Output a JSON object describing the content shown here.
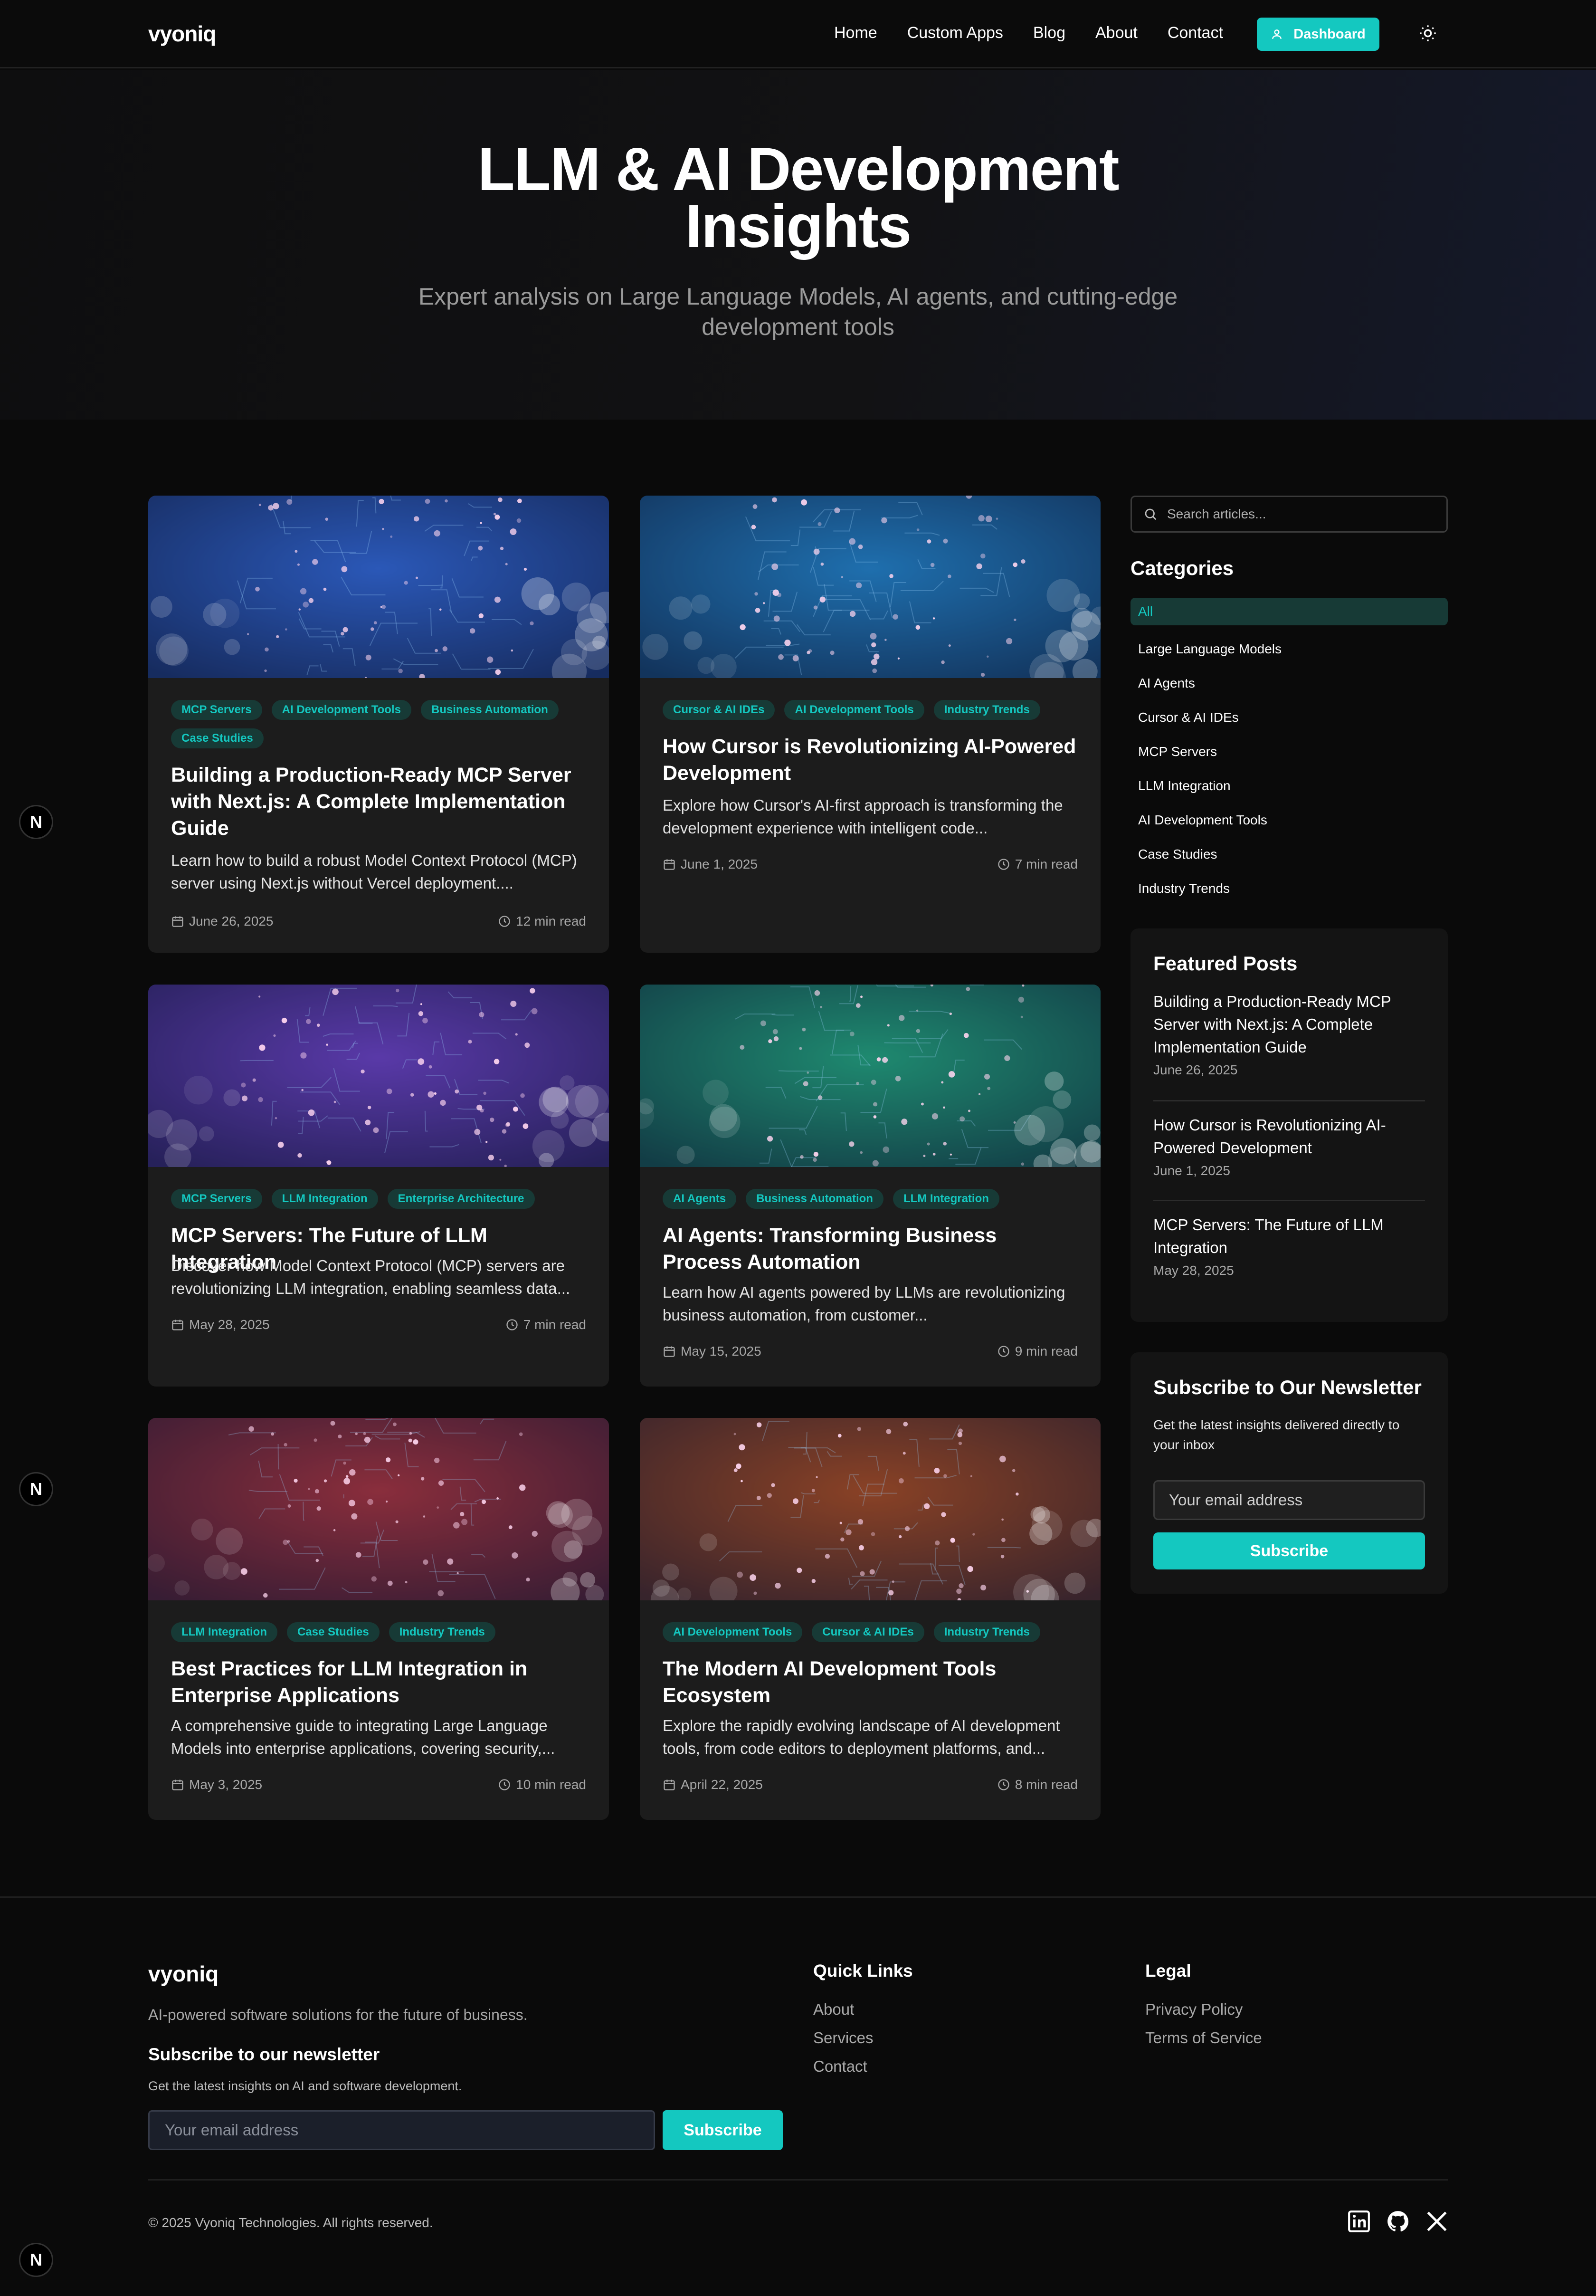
{
  "nav": {
    "logo": "vyoniq",
    "links": [
      "Home",
      "Custom Apps",
      "Blog",
      "About",
      "Contact"
    ],
    "dashboard_label": "Dashboard"
  },
  "hero": {
    "title": "LLM & AI Development Insights",
    "subtitle": "Expert analysis on Large Language Models, AI agents, and cutting-edge development tools"
  },
  "posts": [
    {
      "tags": [
        "MCP Servers",
        "AI Development Tools",
        "Business Automation",
        "Case Studies"
      ],
      "title": "Building a Production-Ready MCP Server with Next.js: A Complete Implementation Guide",
      "excerpt": "Learn how to build a robust Model Context Protocol (MCP) server using Next.js without Vercel deployment....",
      "date": "June 26, 2025",
      "read": "12 min read",
      "color": "#2b58b8"
    },
    {
      "tags": [
        "Cursor & AI IDEs",
        "AI Development Tools",
        "Industry Trends"
      ],
      "title": "How Cursor is Revolutionizing AI-Powered Development",
      "excerpt": "Explore how Cursor's AI-first approach is transforming the development experience with intelligent code...",
      "date": "June 1, 2025",
      "read": "7 min read",
      "color": "#1f6fae"
    },
    {
      "tags": [
        "MCP Servers",
        "LLM Integration",
        "Enterprise Architecture"
      ],
      "title": "MCP Servers: The Future of LLM Integration",
      "excerpt": "Discover how Model Context Protocol (MCP) servers are revolutionizing LLM integration, enabling seamless data...",
      "date": "May 28, 2025",
      "read": "7 min read",
      "color": "#5a3aa8"
    },
    {
      "tags": [
        "AI Agents",
        "Business Automation",
        "LLM Integration"
      ],
      "title": "AI Agents: Transforming Business Process Automation",
      "excerpt": "Learn how AI agents powered by LLMs are revolutionizing business automation, from customer...",
      "date": "May 15, 2025",
      "read": "9 min read",
      "color": "#1f8a70"
    },
    {
      "tags": [
        "LLM Integration",
        "Case Studies",
        "Industry Trends"
      ],
      "title": "Best Practices for LLM Integration in Enterprise Applications",
      "excerpt": "A comprehensive guide to integrating Large Language Models into enterprise applications, covering security,...",
      "date": "May 3, 2025",
      "read": "10 min read",
      "color": "#8a2e3c"
    },
    {
      "tags": [
        "AI Development Tools",
        "Cursor & AI IDEs",
        "Industry Trends"
      ],
      "title": "The Modern AI Development Tools Ecosystem",
      "excerpt": "Explore the rapidly evolving landscape of AI development tools, from code editors to deployment platforms, and...",
      "date": "April 22, 2025",
      "read": "8 min read",
      "color": "#8a4226"
    }
  ],
  "sidebar": {
    "search_placeholder": "Search articles...",
    "categories_title": "Categories",
    "categories": [
      "All",
      "Large Language Models",
      "AI Agents",
      "Cursor & AI IDEs",
      "MCP Servers",
      "LLM Integration",
      "AI Development Tools",
      "Case Studies",
      "Industry Trends"
    ],
    "featured_title": "Featured Posts",
    "featured": [
      {
        "title": "Building a Production-Ready MCP Server with Next.js: A Complete Implementation Guide",
        "date": "June 26, 2025"
      },
      {
        "title": "How Cursor is Revolutionizing AI-Powered Development",
        "date": "June 1, 2025"
      },
      {
        "title": "MCP Servers: The Future of LLM Integration",
        "date": "May 28, 2025"
      }
    ],
    "newsletter_title": "Subscribe to Our Newsletter",
    "newsletter_text": "Get the latest insights delivered directly to your inbox",
    "newsletter_placeholder": "Your email address",
    "newsletter_button": "Subscribe"
  },
  "badge_letter": "N",
  "footer": {
    "logo": "vyoniq",
    "tagline": "AI-powered software solutions for the future of business.",
    "subscribe_title": "Subscribe to our newsletter",
    "subscribe_text": "Get the latest insights on AI and software development.",
    "email_placeholder": "Your email address",
    "subscribe_button": "Subscribe",
    "quick_links_title": "Quick Links",
    "quick_links": [
      "About",
      "Services",
      "Contact"
    ],
    "legal_title": "Legal",
    "legal_links": [
      "Privacy Policy",
      "Terms of Service"
    ],
    "copyright": "© 2025 Vyoniq Technologies. All rights reserved.",
    "socials": [
      "linkedin-icon",
      "github-icon",
      "x-icon"
    ]
  },
  "colors": {
    "accent": "#14c8c0",
    "background": "#0a0a0a",
    "card": "#1c1c1c"
  }
}
